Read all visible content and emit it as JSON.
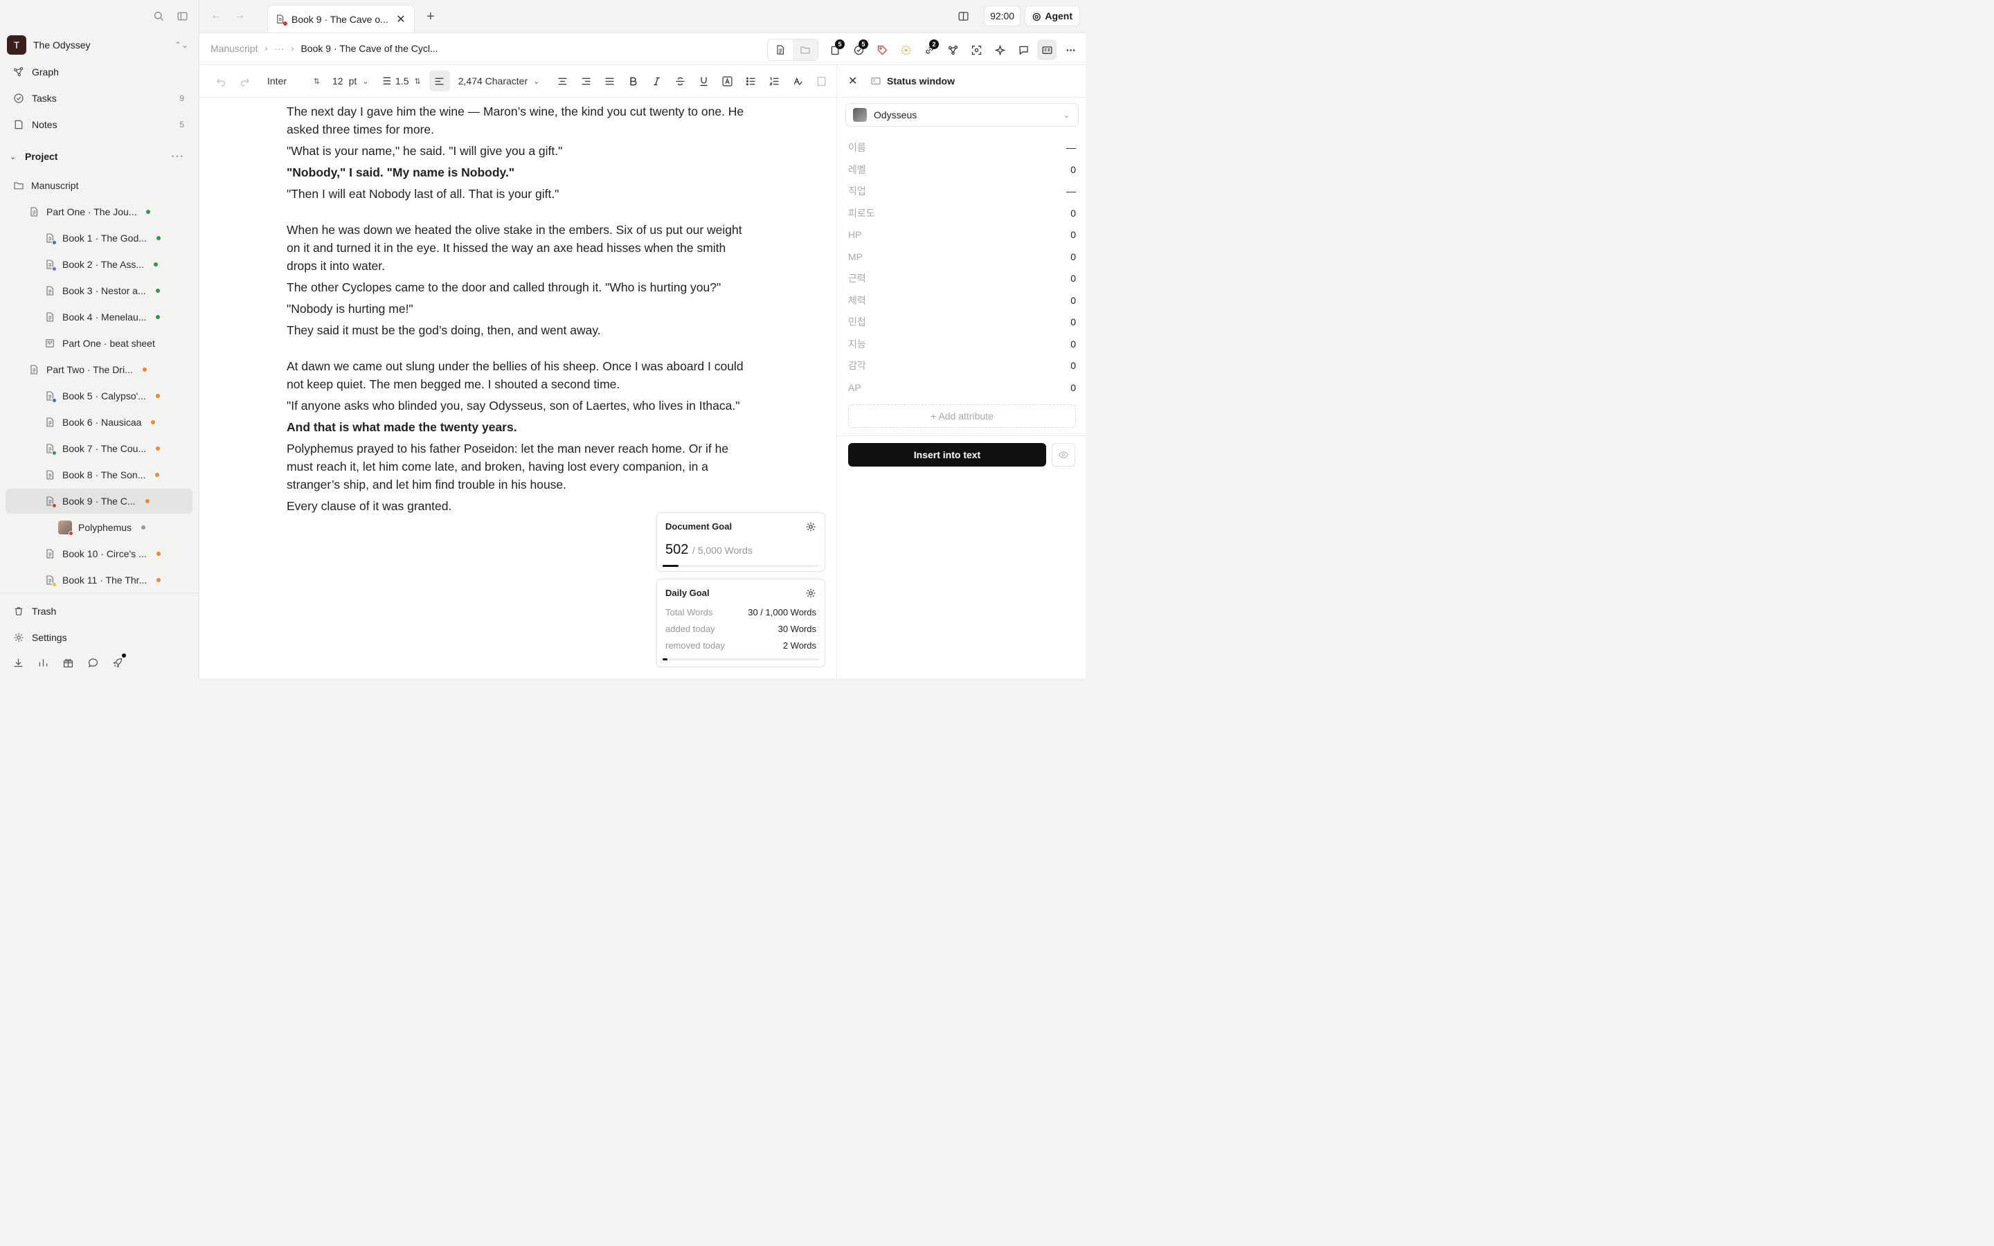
{
  "workspace": {
    "avatar_letter": "T",
    "name": "The Odyssey"
  },
  "nav": [
    {
      "label": "Graph",
      "count": ""
    },
    {
      "label": "Tasks",
      "count": "9"
    },
    {
      "label": "Notes",
      "count": "5"
    }
  ],
  "project": {
    "label": "Project"
  },
  "tree": [
    {
      "label": "Manuscript",
      "icon": "folder-icon",
      "level": 0,
      "dot": "",
      "badge": ""
    },
    {
      "label": "Part One · The Jou...",
      "icon": "document-icon",
      "level": 1,
      "dot": "#2e9a44",
      "badge": ""
    },
    {
      "label": "Book 1 · The God...",
      "icon": "document-icon",
      "level": 2,
      "dot": "#2e9a44",
      "badge": "#2f6fe0"
    },
    {
      "label": "Book 2 · The Ass...",
      "icon": "document-icon",
      "level": 2,
      "dot": "#2e9a44",
      "badge": "#8b5cf6"
    },
    {
      "label": "Book 3 · Nestor a...",
      "icon": "document-icon",
      "level": 2,
      "dot": "#2e9a44",
      "badge": ""
    },
    {
      "label": "Book 4 · Menelau...",
      "icon": "document-icon",
      "level": 2,
      "dot": "#2e9a44",
      "badge": ""
    },
    {
      "label": "Part One · beat sheet",
      "icon": "beat-sheet-icon",
      "level": 2,
      "dot": "",
      "badge": ""
    },
    {
      "label": "Part Two · The Dri...",
      "icon": "document-icon",
      "level": 1,
      "dot": "#f08a24",
      "badge": ""
    },
    {
      "label": "Book 5 · Calypso'...",
      "icon": "document-icon",
      "level": 2,
      "dot": "#f08a24",
      "badge": "#2f6fe0"
    },
    {
      "label": "Book 6 · Nausicaa",
      "icon": "document-icon",
      "level": 2,
      "dot": "#f08a24",
      "badge": ""
    },
    {
      "label": "Book 7 · The Cou...",
      "icon": "document-icon",
      "level": 2,
      "dot": "#f08a24",
      "badge": "#2e9a44"
    },
    {
      "label": "Book 8 · The Son...",
      "icon": "document-icon",
      "level": 2,
      "dot": "#f08a24",
      "badge": ""
    },
    {
      "label": "Book 9 · The C...",
      "icon": "document-icon",
      "level": 2,
      "dot": "#f08a24",
      "badge": "#d33b3b",
      "active": true
    },
    {
      "label": "Polyphemus",
      "icon": "character-image",
      "level": 3,
      "dot": "#9a9a9a",
      "badge": "#d33b3b"
    },
    {
      "label": "Book 10 · Circe's ...",
      "icon": "document-icon",
      "level": 2,
      "dot": "#f08a24",
      "badge": ""
    },
    {
      "label": "Book 11 · The Thr...",
      "icon": "document-icon",
      "level": 2,
      "dot": "#f08a24",
      "badge": "#f0c020"
    }
  ],
  "sidebar_bottom": {
    "trash": "Trash",
    "settings": "Settings"
  },
  "tab": {
    "title": "Book 9 · The Cave o..."
  },
  "timer": "92:00",
  "agent": "Agent",
  "breadcrumb": {
    "root": "Manuscript",
    "ellipsis": "···",
    "current": "Book 9 · The Cave of the Cycl..."
  },
  "doc_tool_badges": {
    "pages": "5",
    "tasks": "5",
    "links": "2"
  },
  "format": {
    "font": "Inter",
    "size": "12",
    "unit": "pt",
    "line_height": "1.5",
    "count": "2,474 Character"
  },
  "editor": {
    "paragraphs": [
      {
        "text": "The next day I gave him the wine — Maron’s wine, the kind you cut twenty to one. He asked three times for more.",
        "bold": false,
        "gap": false
      },
      {
        "text": "\"What is your name,\" he said. \"I will give you a gift.\"",
        "bold": false,
        "gap": false
      },
      {
        "text": "\"Nobody,\" I said. \"My name is Nobody.\"",
        "bold": true,
        "gap": false
      },
      {
        "text": "\"Then I will eat Nobody last of all. That is your gift.\"",
        "bold": false,
        "gap": false
      },
      {
        "text": "When he was down we heated the olive stake in the embers. Six of us put our weight on it and turned it in the eye. It hissed the way an axe head hisses when the smith drops it into water.",
        "bold": false,
        "gap": true
      },
      {
        "text": "The other Cyclopes came to the door and called through it. \"Who is hurting you?\"",
        "bold": false,
        "gap": false
      },
      {
        "text": "\"Nobody is hurting me!\"",
        "bold": false,
        "gap": false
      },
      {
        "text": "They said it must be the god’s doing, then, and went away.",
        "bold": false,
        "gap": false
      },
      {
        "text": "At dawn we came out slung under the bellies of his sheep. Once I was aboard I could not keep quiet. The men begged me. I shouted a second time.",
        "bold": false,
        "gap": true
      },
      {
        "text": "\"If anyone asks who blinded you, say Odysseus, son of Laertes, who lives in Ithaca.\"",
        "bold": false,
        "gap": false
      },
      {
        "text": "And that is what made the twenty years.",
        "bold": true,
        "gap": false
      },
      {
        "text": "Polyphemus prayed to his father Poseidon: let the man never reach home. Or if he must reach it, let him come late, and broken, having lost every companion, in a stranger’s ship, and let him find trouble in his house.",
        "bold": false,
        "gap": false
      },
      {
        "text": "Every clause of it was granted.",
        "bold": false,
        "gap": false
      }
    ]
  },
  "document_goal": {
    "title": "Document Goal",
    "current": "502",
    "target": "/ 5,000 Words",
    "progress": 0.1
  },
  "daily_goal": {
    "title": "Daily Goal",
    "rows": [
      {
        "k": "Total Words",
        "v": "30 / 1,000 Words"
      },
      {
        "k": "added today",
        "v": "30 Words"
      },
      {
        "k": "removed today",
        "v": "2 Words"
      }
    ],
    "progress": 0.03
  },
  "status_window": {
    "title": "Status window",
    "character": "Odysseus",
    "attributes": [
      {
        "k": "이름",
        "v": "—"
      },
      {
        "k": "레벨",
        "v": "0"
      },
      {
        "k": "직업",
        "v": "—"
      },
      {
        "k": "피로도",
        "v": "0"
      },
      {
        "k": "HP",
        "v": "0"
      },
      {
        "k": "MP",
        "v": "0"
      },
      {
        "k": "근력",
        "v": "0"
      },
      {
        "k": "체력",
        "v": "0"
      },
      {
        "k": "민첩",
        "v": "0"
      },
      {
        "k": "지능",
        "v": "0"
      },
      {
        "k": "감각",
        "v": "0"
      },
      {
        "k": "AP",
        "v": "0"
      }
    ],
    "add_label": "+ Add attribute",
    "insert_label": "Insert into text"
  }
}
